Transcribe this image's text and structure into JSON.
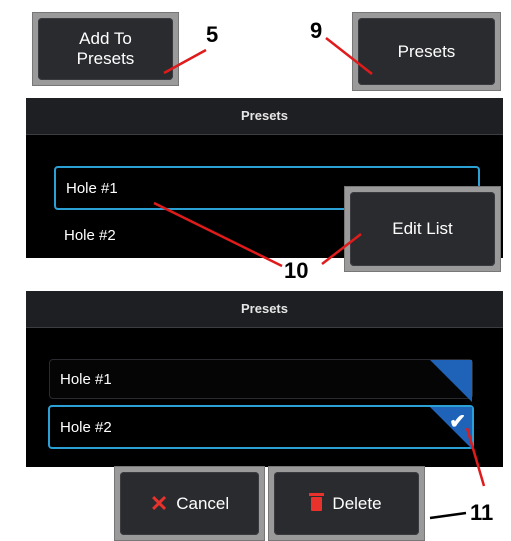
{
  "buttons": {
    "add_to_presets": "Add To\nPresets",
    "presets": "Presets",
    "edit_list": "Edit List",
    "cancel": "Cancel",
    "delete": "Delete"
  },
  "panel1": {
    "title": "Presets",
    "items": [
      "Hole #1",
      "Hole #2"
    ]
  },
  "panel2": {
    "title": "Presets",
    "items": [
      "Hole #1",
      "Hole #2"
    ]
  },
  "callouts": {
    "c5": "5",
    "c9": "9",
    "c10": "10",
    "c11": "11"
  },
  "colors": {
    "accent": "#2aa0d4",
    "callout_line": "#e01b1b",
    "corner": "#1e63b8"
  },
  "icons": {
    "cancel": "x-icon",
    "delete": "trash-icon",
    "checked": "checkmark-icon"
  }
}
